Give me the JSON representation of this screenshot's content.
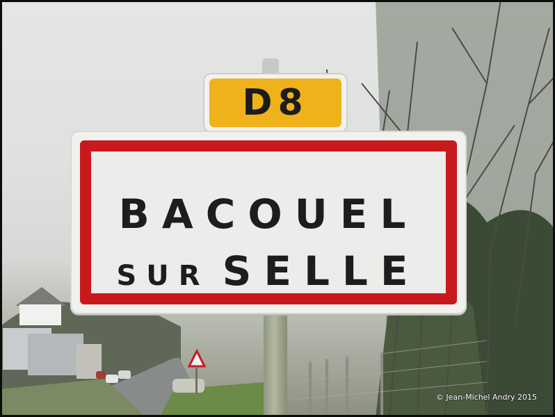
{
  "route_sign": {
    "text": "D8",
    "color": "#f0b21b"
  },
  "town_sign": {
    "line1": "BACOUEL",
    "line2_small": "SUR",
    "line2_big": "SELLE",
    "border_color": "#c8191d"
  },
  "credit": "©  Jean-Michel Andry 2015"
}
